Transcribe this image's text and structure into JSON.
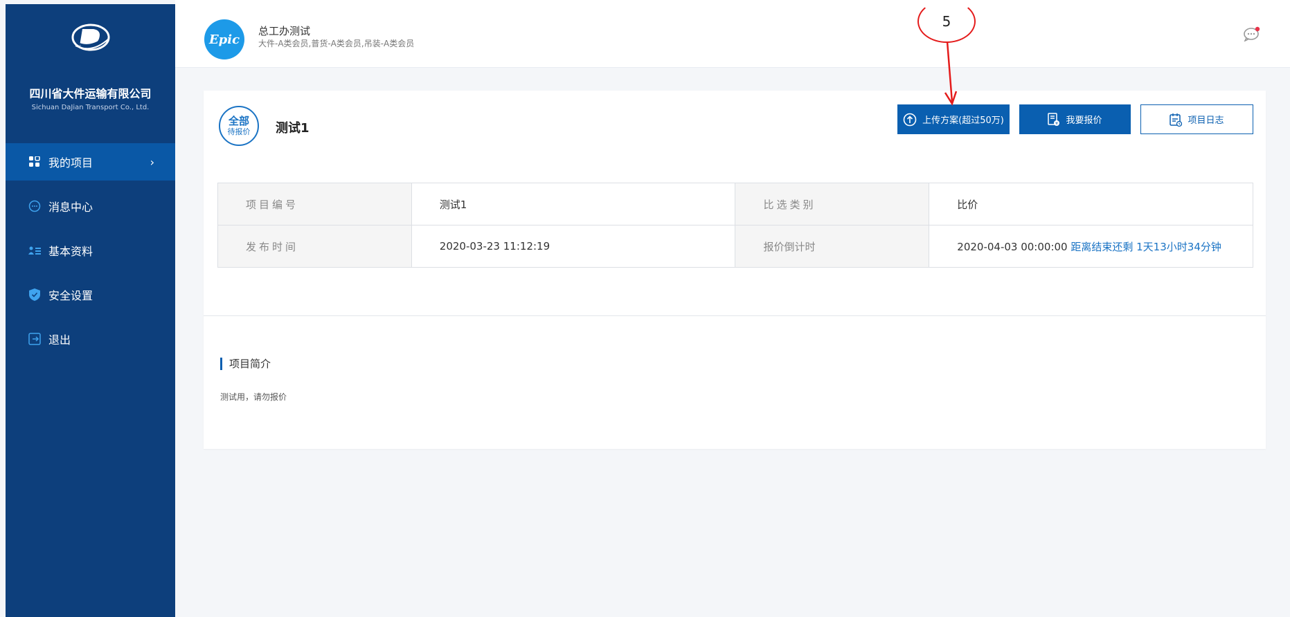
{
  "sidebar": {
    "company_name": "四川省大件运输有限公司",
    "company_en": "Sichuan DaJian Transport Co., Ltd.",
    "items": [
      {
        "label": "我的项目",
        "icon": "grid-icon",
        "active": true
      },
      {
        "label": "消息中心",
        "icon": "message-icon"
      },
      {
        "label": "基本资料",
        "icon": "profile-icon"
      },
      {
        "label": "安全设置",
        "icon": "shield-icon"
      },
      {
        "label": "退出",
        "icon": "logout-icon"
      }
    ],
    "chevron": "›"
  },
  "header": {
    "avatar_text": "Epic",
    "user_name": "总工办测试",
    "membership": "大件-A类会员,普货-A类会员,吊装-A类会员"
  },
  "project": {
    "status_line1": "全部",
    "status_line2": "待报价",
    "title": "测试1",
    "buttons": {
      "upload": "上传方案(超过50万)",
      "quote": "我要报价",
      "log": "项目日志"
    },
    "table": {
      "r1": {
        "label1": "项目编号",
        "value1": "测试1",
        "label2": "比选类别",
        "value2": "比价"
      },
      "r2": {
        "label1": "发布时间",
        "value1": "2020-03-23 11:12:19",
        "label2": "报价倒计时",
        "value2_date": "2020-04-03 00:00:00",
        "value2_countdown": "距离结束还剩 1天13小时34分钟"
      }
    },
    "intro_title": "项目简介",
    "intro_text": "测试用，请勿报价"
  },
  "annotation": {
    "number": "5",
    "color": "#e41b1b"
  },
  "colors": {
    "sidebar_bg": "#0d3f7c",
    "active_bg": "#0a58a6",
    "primary": "#0a5fb0"
  }
}
